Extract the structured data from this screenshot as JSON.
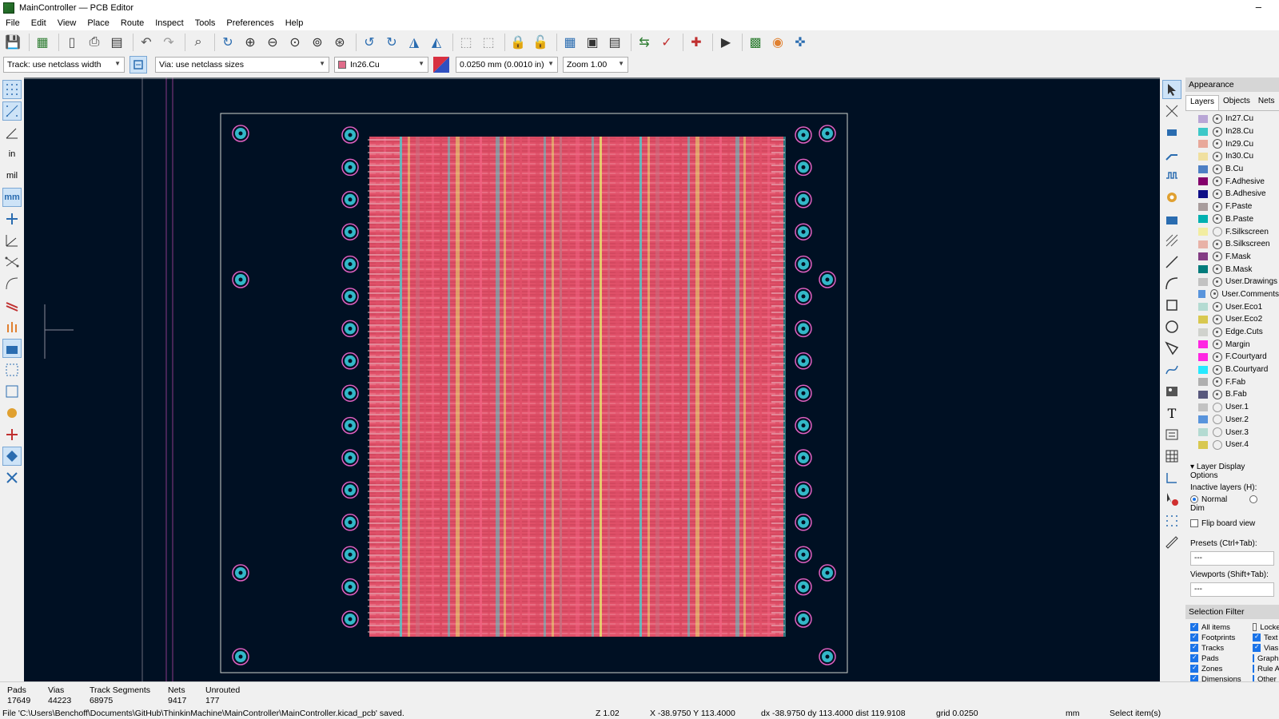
{
  "window": {
    "title": "MainController — PCB Editor",
    "minimize": "–"
  },
  "menu": [
    "File",
    "Edit",
    "View",
    "Place",
    "Route",
    "Inspect",
    "Tools",
    "Preferences",
    "Help"
  ],
  "toolbar_icons": [
    "save-icon",
    "board-setup-icon",
    "new-icon",
    "print-icon",
    "plot-icon",
    "undo-icon",
    "redo-icon",
    "find-icon",
    "refresh-icon",
    "zoom-in-icon",
    "zoom-out-icon",
    "zoom-fit-icon",
    "zoom-objects-icon",
    "zoom-selection-icon",
    "rotate-ccw-icon",
    "rotate-cw-icon",
    "flip-icon",
    "mirror-icon",
    "group-icon",
    "ungroup-icon",
    "lock-icon",
    "unlock-icon",
    "netlist-icon",
    "footprint-editor-icon",
    "footprint-browser-icon",
    "update-pcb-icon",
    "drc-icon",
    "autoroute-icon",
    "scripting-icon",
    "zone-icon",
    "3d-viewer-icon",
    "plugin-icon"
  ],
  "options": {
    "track": "Track: use netclass width",
    "via": "Via: use netclass sizes",
    "layer": "In26.Cu",
    "layer_color": "#e06c8a",
    "grid": "0.0250 mm (0.0010 in)",
    "zoom": "Zoom 1.00"
  },
  "appearance": {
    "title": "Appearance",
    "tabs": [
      "Layers",
      "Objects",
      "Nets"
    ],
    "layers": [
      {
        "name": "In27.Cu",
        "color": "#b9a6d6",
        "visible": true
      },
      {
        "name": "In28.Cu",
        "color": "#3dc8c8",
        "visible": true
      },
      {
        "name": "In29.Cu",
        "color": "#e8a89a",
        "visible": true
      },
      {
        "name": "In30.Cu",
        "color": "#f0e0a0",
        "visible": true
      },
      {
        "name": "B.Cu",
        "color": "#4d7fc4",
        "visible": true
      },
      {
        "name": "F.Adhesive",
        "color": "#84006b",
        "visible": true
      },
      {
        "name": "B.Adhesive",
        "color": "#0f0f87",
        "visible": true
      },
      {
        "name": "F.Paste",
        "color": "#a89c9c",
        "visible": true
      },
      {
        "name": "B.Paste",
        "color": "#00b0b0",
        "visible": true
      },
      {
        "name": "F.Silkscreen",
        "color": "#f2eda1",
        "visible": false
      },
      {
        "name": "B.Silkscreen",
        "color": "#e8b2a7",
        "visible": true
      },
      {
        "name": "F.Mask",
        "color": "#833d83",
        "visible": true
      },
      {
        "name": "B.Mask",
        "color": "#027c7c",
        "visible": true
      },
      {
        "name": "User.Drawings",
        "color": "#c2c2c2",
        "visible": true
      },
      {
        "name": "User.Comments",
        "color": "#5994dc",
        "visible": true
      },
      {
        "name": "User.Eco1",
        "color": "#b4dbd2",
        "visible": true
      },
      {
        "name": "User.Eco2",
        "color": "#d8c850",
        "visible": true
      },
      {
        "name": "Edge.Cuts",
        "color": "#d0d2cd",
        "visible": true
      },
      {
        "name": "Margin",
        "color": "#ff26e2",
        "visible": true
      },
      {
        "name": "F.Courtyard",
        "color": "#ff26e2",
        "visible": true
      },
      {
        "name": "B.Courtyard",
        "color": "#26e9ff",
        "visible": true
      },
      {
        "name": "F.Fab",
        "color": "#afafaf",
        "visible": true
      },
      {
        "name": "B.Fab",
        "color": "#58587c",
        "visible": true
      },
      {
        "name": "User.1",
        "color": "#c2c2c2",
        "visible": false
      },
      {
        "name": "User.2",
        "color": "#5994dc",
        "visible": false
      },
      {
        "name": "User.3",
        "color": "#b4dbd2",
        "visible": false
      },
      {
        "name": "User.4",
        "color": "#d8c850",
        "visible": false
      }
    ],
    "layer_display_options": "Layer Display Options",
    "inactive_layers": "Inactive layers (H):",
    "normal": "Normal",
    "dim": "Dim",
    "flip_board": "Flip board view",
    "presets_label": "Presets (Ctrl+Tab):",
    "presets_value": "---",
    "viewports_label": "Viewports (Shift+Tab):",
    "viewports_value": "---",
    "selection_filter": "Selection Filter",
    "filters": [
      {
        "label": "All items",
        "checked": true
      },
      {
        "label": "Locked",
        "checked": false
      },
      {
        "label": "Footprints",
        "checked": true
      },
      {
        "label": "Text",
        "checked": true
      },
      {
        "label": "Tracks",
        "checked": true
      },
      {
        "label": "Vias",
        "checked": true
      },
      {
        "label": "Pads",
        "checked": true
      },
      {
        "label": "Graphics",
        "checked": true
      },
      {
        "label": "Zones",
        "checked": true
      },
      {
        "label": "Rule Areas",
        "checked": true
      },
      {
        "label": "Dimensions",
        "checked": true
      },
      {
        "label": "Other items",
        "checked": true
      }
    ]
  },
  "status": {
    "pads_label": "Pads",
    "pads": "17649",
    "vias_label": "Vias",
    "vias": "44223",
    "segments_label": "Track Segments",
    "segments": "68975",
    "nets_label": "Nets",
    "nets": "9417",
    "unrouted_label": "Unrouted",
    "unrouted": "177",
    "file_msg": "File 'C:\\Users\\Benchoff\\Documents\\GitHub\\ThinkinMachine\\MainController\\MainController.kicad_pcb' saved.",
    "zoom": "Z 1.02",
    "coords": "X -38.9750  Y 113.4000",
    "delta": "dx -38.9750  dy 113.4000  dist 119.9108",
    "grid": "grid 0.0250",
    "units": "mm",
    "mode": "Select item(s)"
  },
  "pcb": {
    "track_colors": [
      "#e0506a",
      "#f06080",
      "#d84860",
      "#55c8c8",
      "#e8e070",
      "#c87080"
    ]
  }
}
